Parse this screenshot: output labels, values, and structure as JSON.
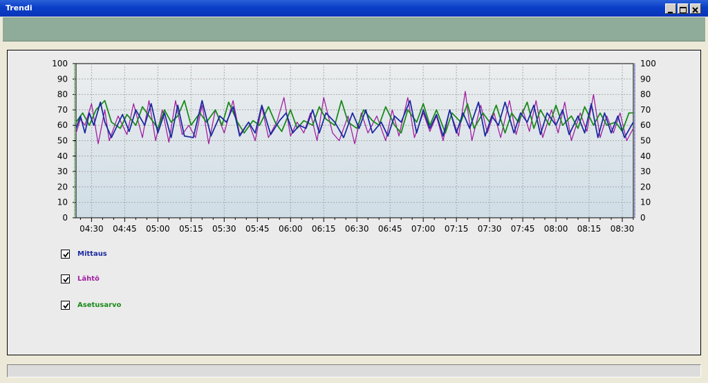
{
  "window": {
    "title": "Trendi"
  },
  "legend": [
    {
      "label": "Mittaus",
      "color": "#1b2aa0",
      "checked": true
    },
    {
      "label": "Lähtö",
      "color": "#a020a0",
      "checked": true
    },
    {
      "label": "Asetusarvo",
      "color": "#1a8a1a",
      "checked": true
    }
  ],
  "chart_data": {
    "type": "line",
    "x_start": "04:23",
    "x_end": "08:35",
    "xlim": [
      "04:23",
      "08:35"
    ],
    "ylim": [
      0,
      100
    ],
    "y_ticks": [
      0,
      10,
      20,
      30,
      40,
      50,
      60,
      70,
      80,
      90,
      100
    ],
    "x_ticks": [
      "04:30",
      "04:45",
      "05:00",
      "05:15",
      "05:30",
      "05:45",
      "06:00",
      "06:15",
      "06:30",
      "06:45",
      "07:00",
      "07:15",
      "07:30",
      "07:45",
      "08:00",
      "08:15",
      "08:30"
    ],
    "grid": true,
    "series": [
      {
        "name": "Mittaus",
        "color": "#1b2aa0",
        "x": [
          "04:23",
          "04:25",
          "04:27",
          "04:29",
          "04:31",
          "04:34",
          "04:36",
          "04:39",
          "04:44",
          "04:47",
          "04:50",
          "04:54",
          "04:57",
          "05:00",
          "05:03",
          "05:06",
          "05:09",
          "05:12",
          "05:16",
          "05:20",
          "05:24",
          "05:28",
          "05:31",
          "05:34",
          "05:37",
          "05:41",
          "05:44",
          "05:47",
          "05:51",
          "05:55",
          "05:58",
          "06:01",
          "06:04",
          "06:07",
          "06:10",
          "06:13",
          "06:16",
          "06:20",
          "06:24",
          "06:28",
          "06:31",
          "06:34",
          "06:37",
          "06:41",
          "06:44",
          "06:47",
          "06:50",
          "06:54",
          "06:57",
          "07:00",
          "07:03",
          "07:06",
          "07:09",
          "07:12",
          "07:15",
          "07:18",
          "07:21",
          "07:25",
          "07:28",
          "07:31",
          "07:34",
          "07:37",
          "07:41",
          "07:44",
          "07:47",
          "07:50",
          "07:53",
          "07:56",
          "08:00",
          "08:03",
          "08:06",
          "08:10",
          "08:13",
          "08:16",
          "08:19",
          "08:22",
          "08:25",
          "08:28",
          "08:31",
          "08:35"
        ],
        "y": [
          58,
          66,
          55,
          68,
          60,
          75,
          62,
          52,
          67,
          56,
          70,
          60,
          74,
          55,
          68,
          52,
          73,
          53,
          52,
          76,
          53,
          66,
          62,
          72,
          53,
          62,
          55,
          73,
          54,
          63,
          68,
          55,
          60,
          58,
          70,
          55,
          68,
          62,
          52,
          68,
          58,
          70,
          55,
          62,
          53,
          66,
          62,
          76,
          55,
          70,
          58,
          67,
          53,
          70,
          55,
          68,
          58,
          75,
          53,
          66,
          60,
          75,
          55,
          68,
          62,
          73,
          54,
          68,
          60,
          70,
          54,
          66,
          55,
          74,
          52,
          68,
          55,
          66,
          52,
          62
        ]
      },
      {
        "name": "Lähtö",
        "color": "#a020a0",
        "x": [
          "04:23",
          "04:25",
          "04:27",
          "04:30",
          "04:33",
          "04:36",
          "04:38",
          "04:42",
          "04:46",
          "04:49",
          "04:53",
          "04:56",
          "04:59",
          "05:02",
          "05:05",
          "05:08",
          "05:11",
          "05:14",
          "05:17",
          "05:20",
          "05:23",
          "05:26",
          "05:30",
          "05:34",
          "05:37",
          "05:41",
          "05:44",
          "05:47",
          "05:50",
          "05:54",
          "05:57",
          "06:00",
          "06:03",
          "06:06",
          "06:09",
          "06:12",
          "06:15",
          "06:19",
          "06:22",
          "06:26",
          "06:29",
          "06:32",
          "06:35",
          "06:39",
          "06:43",
          "06:46",
          "06:49",
          "06:53",
          "06:56",
          "07:00",
          "07:03",
          "07:06",
          "07:09",
          "07:12",
          "07:16",
          "07:19",
          "07:22",
          "07:26",
          "07:29",
          "07:32",
          "07:35",
          "07:39",
          "07:42",
          "07:45",
          "07:48",
          "07:51",
          "07:54",
          "07:58",
          "08:01",
          "08:04",
          "08:07",
          "08:11",
          "08:14",
          "08:17",
          "08:20",
          "08:23",
          "08:26",
          "08:29",
          "08:32",
          "08:35"
        ],
        "y": [
          55,
          64,
          60,
          74,
          48,
          70,
          50,
          66,
          54,
          74,
          52,
          76,
          50,
          70,
          49,
          76,
          54,
          60,
          52,
          73,
          48,
          70,
          55,
          76,
          54,
          62,
          50,
          72,
          52,
          63,
          78,
          53,
          62,
          55,
          68,
          50,
          78,
          55,
          50,
          66,
          48,
          68,
          55,
          66,
          50,
          70,
          53,
          78,
          52,
          68,
          56,
          66,
          50,
          70,
          53,
          82,
          50,
          73,
          55,
          68,
          52,
          76,
          54,
          70,
          56,
          76,
          52,
          70,
          55,
          75,
          50,
          68,
          56,
          80,
          52,
          66,
          55,
          68,
          50,
          58
        ]
      },
      {
        "name": "Asetusarvo",
        "color": "#1a8a1a",
        "x": [
          "04:23",
          "04:26",
          "04:29",
          "04:32",
          "04:36",
          "04:39",
          "04:43",
          "04:46",
          "04:50",
          "04:53",
          "04:56",
          "05:00",
          "05:03",
          "05:06",
          "05:09",
          "05:12",
          "05:15",
          "05:19",
          "05:22",
          "05:26",
          "05:29",
          "05:32",
          "05:36",
          "05:39",
          "05:43",
          "05:46",
          "05:50",
          "05:53",
          "05:56",
          "06:00",
          "06:03",
          "06:06",
          "06:10",
          "06:13",
          "06:16",
          "06:20",
          "06:23",
          "06:26",
          "06:30",
          "06:33",
          "06:37",
          "06:40",
          "06:43",
          "06:47",
          "06:50",
          "06:53",
          "06:57",
          "07:00",
          "07:03",
          "07:06",
          "07:10",
          "07:13",
          "07:17",
          "07:20",
          "07:23",
          "07:27",
          "07:30",
          "07:33",
          "07:37",
          "07:40",
          "07:43",
          "07:47",
          "07:50",
          "07:53",
          "07:57",
          "08:00",
          "08:03",
          "08:07",
          "08:10",
          "08:13",
          "08:17",
          "08:20",
          "08:23",
          "08:27",
          "08:30",
          "08:33",
          "08:35"
        ],
        "y": [
          62,
          68,
          60,
          70,
          76,
          62,
          58,
          67,
          60,
          72,
          66,
          58,
          70,
          62,
          66,
          76,
          60,
          68,
          62,
          70,
          60,
          75,
          62,
          55,
          63,
          60,
          72,
          62,
          56,
          70,
          58,
          63,
          60,
          72,
          64,
          60,
          76,
          62,
          58,
          70,
          63,
          60,
          72,
          60,
          55,
          70,
          62,
          74,
          60,
          70,
          55,
          68,
          62,
          74,
          58,
          68,
          62,
          73,
          55,
          68,
          62,
          75,
          58,
          70,
          60,
          73,
          60,
          66,
          58,
          72,
          60,
          68,
          60,
          62,
          56,
          68,
          68
        ]
      }
    ]
  }
}
